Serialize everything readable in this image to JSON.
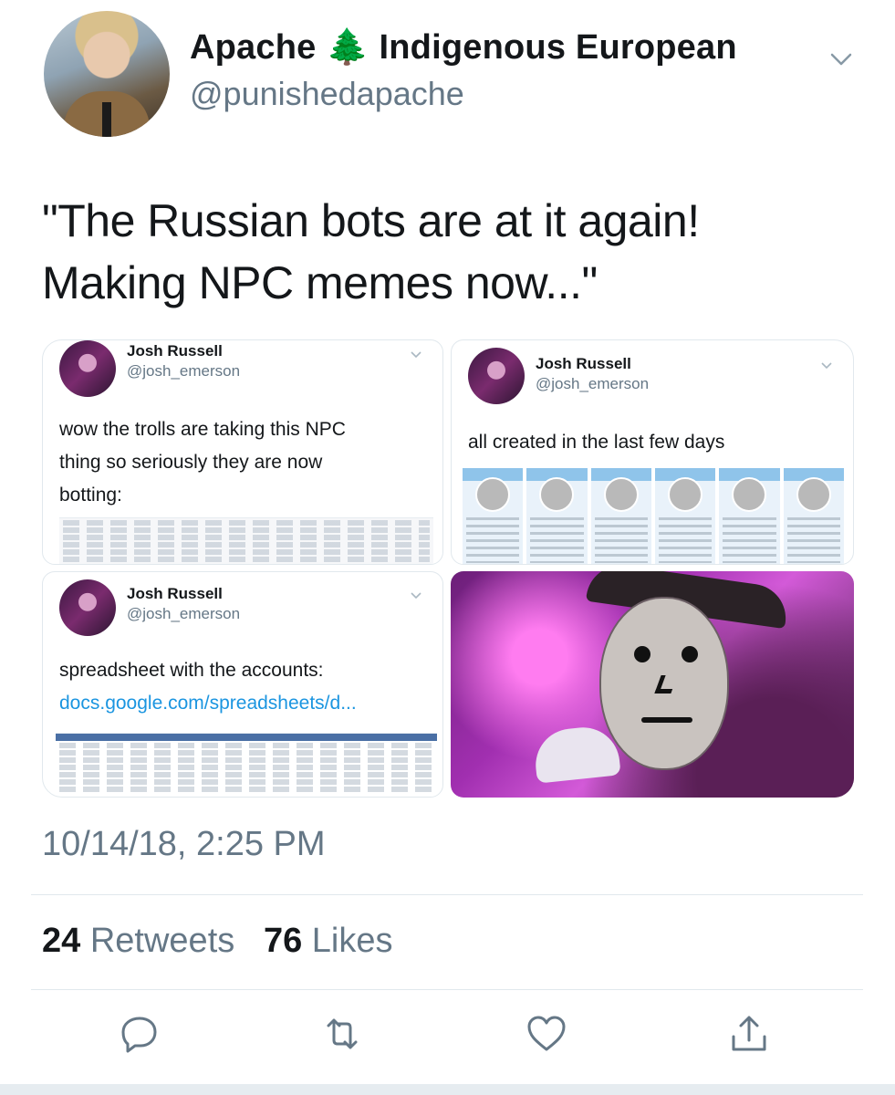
{
  "tweet": {
    "display_name": "Apache 🌲 Indigenous European",
    "handle": "@punishedapache",
    "text_line1": "\"The Russian bots are at it again!",
    "text_line2": "Making NPC memes now...\"",
    "timestamp": "10/14/18, 2:25 PM",
    "retweets_count": "24",
    "retweets_label": "Retweets",
    "likes_count": "76",
    "likes_label": "Likes"
  },
  "embedded": [
    {
      "name": "Josh Russell",
      "handle": "@josh_emerson",
      "text": [
        "wow the trolls are taking this NPC",
        "thing so seriously they are now",
        "botting:"
      ]
    },
    {
      "name": "Josh Russell",
      "handle": "@josh_emerson",
      "text": [
        "all created in the last few days"
      ]
    },
    {
      "name": "Josh Russell",
      "handle": "@josh_emerson",
      "text": [
        "spreadsheet with the accounts:"
      ],
      "link": "docs.google.com/spreadsheets/d..."
    }
  ],
  "icons": {
    "reply": "reply-icon",
    "retweet": "retweet-icon",
    "like": "heart-icon",
    "share": "share-icon",
    "more": "chevron-down-icon"
  },
  "colors": {
    "text": "#14171a",
    "secondary": "#657786",
    "link": "#1b95e0",
    "border": "#e1e8ed"
  }
}
